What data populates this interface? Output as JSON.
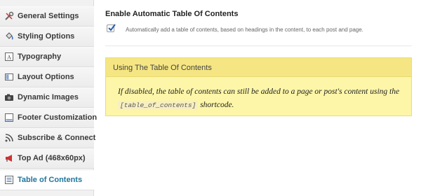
{
  "sidebar": {
    "items": [
      {
        "label": "General Settings",
        "icon": "wrench-screwdriver-icon"
      },
      {
        "label": "Styling Options",
        "icon": "paint-bucket-icon"
      },
      {
        "label": "Typography",
        "icon": "font-icon"
      },
      {
        "label": "Layout Options",
        "icon": "layout-icon"
      },
      {
        "label": "Dynamic Images",
        "icon": "camera-icon"
      },
      {
        "label": "Footer Customization",
        "icon": "footer-icon"
      },
      {
        "label": "Subscribe & Connect",
        "icon": "rss-icon"
      },
      {
        "label": "Top Ad (468x60px)",
        "icon": "megaphone-icon"
      },
      {
        "label": "Table of Contents",
        "icon": "table-of-contents-icon",
        "active": true
      }
    ]
  },
  "main": {
    "title": "Enable Automatic Table Of Contents",
    "checkbox": {
      "checked": true,
      "description": "Automatically add a table of contents, based on headings in the content, to each post and page."
    },
    "notice": {
      "title": "Using The Table Of Contents",
      "text_before": "If disabled, the table of contents can still be added to a page or post's content using the",
      "shortcode": "[table_of_contents]",
      "text_after": "shortcode."
    }
  },
  "colors": {
    "accent": "#21759b",
    "notice_bg": "#fdf6a8",
    "notice_header_bg": "#f5e683",
    "checkbox_check": "#2a5fa5"
  }
}
